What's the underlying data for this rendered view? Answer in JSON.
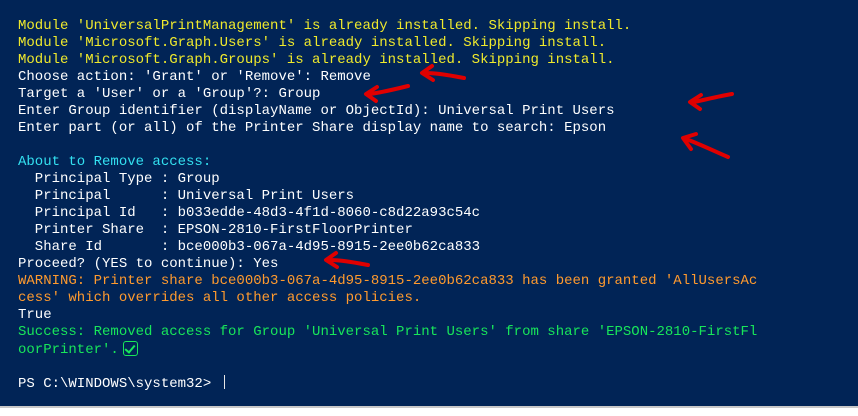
{
  "terminal": {
    "lines": [
      {
        "text": "Module 'UniversalPrintManagement' is already installed. Skipping install.",
        "color": "#f0ea2c"
      },
      {
        "text": "Module 'Microsoft.Graph.Users' is already installed. Skipping install.",
        "color": "#f0ea2c"
      },
      {
        "text": "Module 'Microsoft.Graph.Groups' is already installed. Skipping install.",
        "color": "#f0ea2c"
      },
      {
        "text": "Choose action: 'Grant' or 'Remove': Remove",
        "color": "#ffffff"
      },
      {
        "text": "Target a 'User' or a 'Group'?: Group",
        "color": "#ffffff"
      },
      {
        "text": "Enter Group identifier (displayName or ObjectId): Universal Print Users",
        "color": "#ffffff"
      },
      {
        "text": "Enter part (or all) of the Printer Share display name to search: Epson",
        "color": "#ffffff"
      },
      {
        "text": "About to Remove access:",
        "color": "#33e0f0"
      },
      {
        "text": "  Principal Type : Group",
        "color": "#ffffff"
      },
      {
        "text": "  Principal      : Universal Print Users",
        "color": "#ffffff"
      },
      {
        "text": "  Principal Id   : b033edde-48d3-4f1d-8060-c8d22a93c54c",
        "color": "#ffffff"
      },
      {
        "text": "  Printer Share  : EPSON-2810-FirstFloorPrinter",
        "color": "#ffffff"
      },
      {
        "text": "  Share Id       : bce000b3-067a-4d95-8915-2ee0b62ca833",
        "color": "#ffffff"
      },
      {
        "text": "Proceed? (YES to continue): Yes",
        "color": "#ffffff"
      },
      {
        "text": "WARNING: Printer share bce000b3-067a-4d95-8915-2ee0b62ca833 has been granted 'AllUsersAc",
        "color": "#ff9a2e"
      },
      {
        "text": "cess' which overrides all other access policies.",
        "color": "#ff9a2e"
      },
      {
        "text": "True",
        "color": "#ffffff"
      },
      {
        "text": "Success: Removed access for Group 'Universal Print Users' from share 'EPSON-2810-FirstFl",
        "color": "#18e65a"
      },
      {
        "text": "oorPrinter'.",
        "color": "#18e65a"
      },
      {
        "text": "PS C:\\WINDOWS\\system32> ",
        "color": "#ffffff"
      }
    ]
  },
  "annotations": {
    "arrow_color": "#e00000",
    "arrow_count": 6
  }
}
